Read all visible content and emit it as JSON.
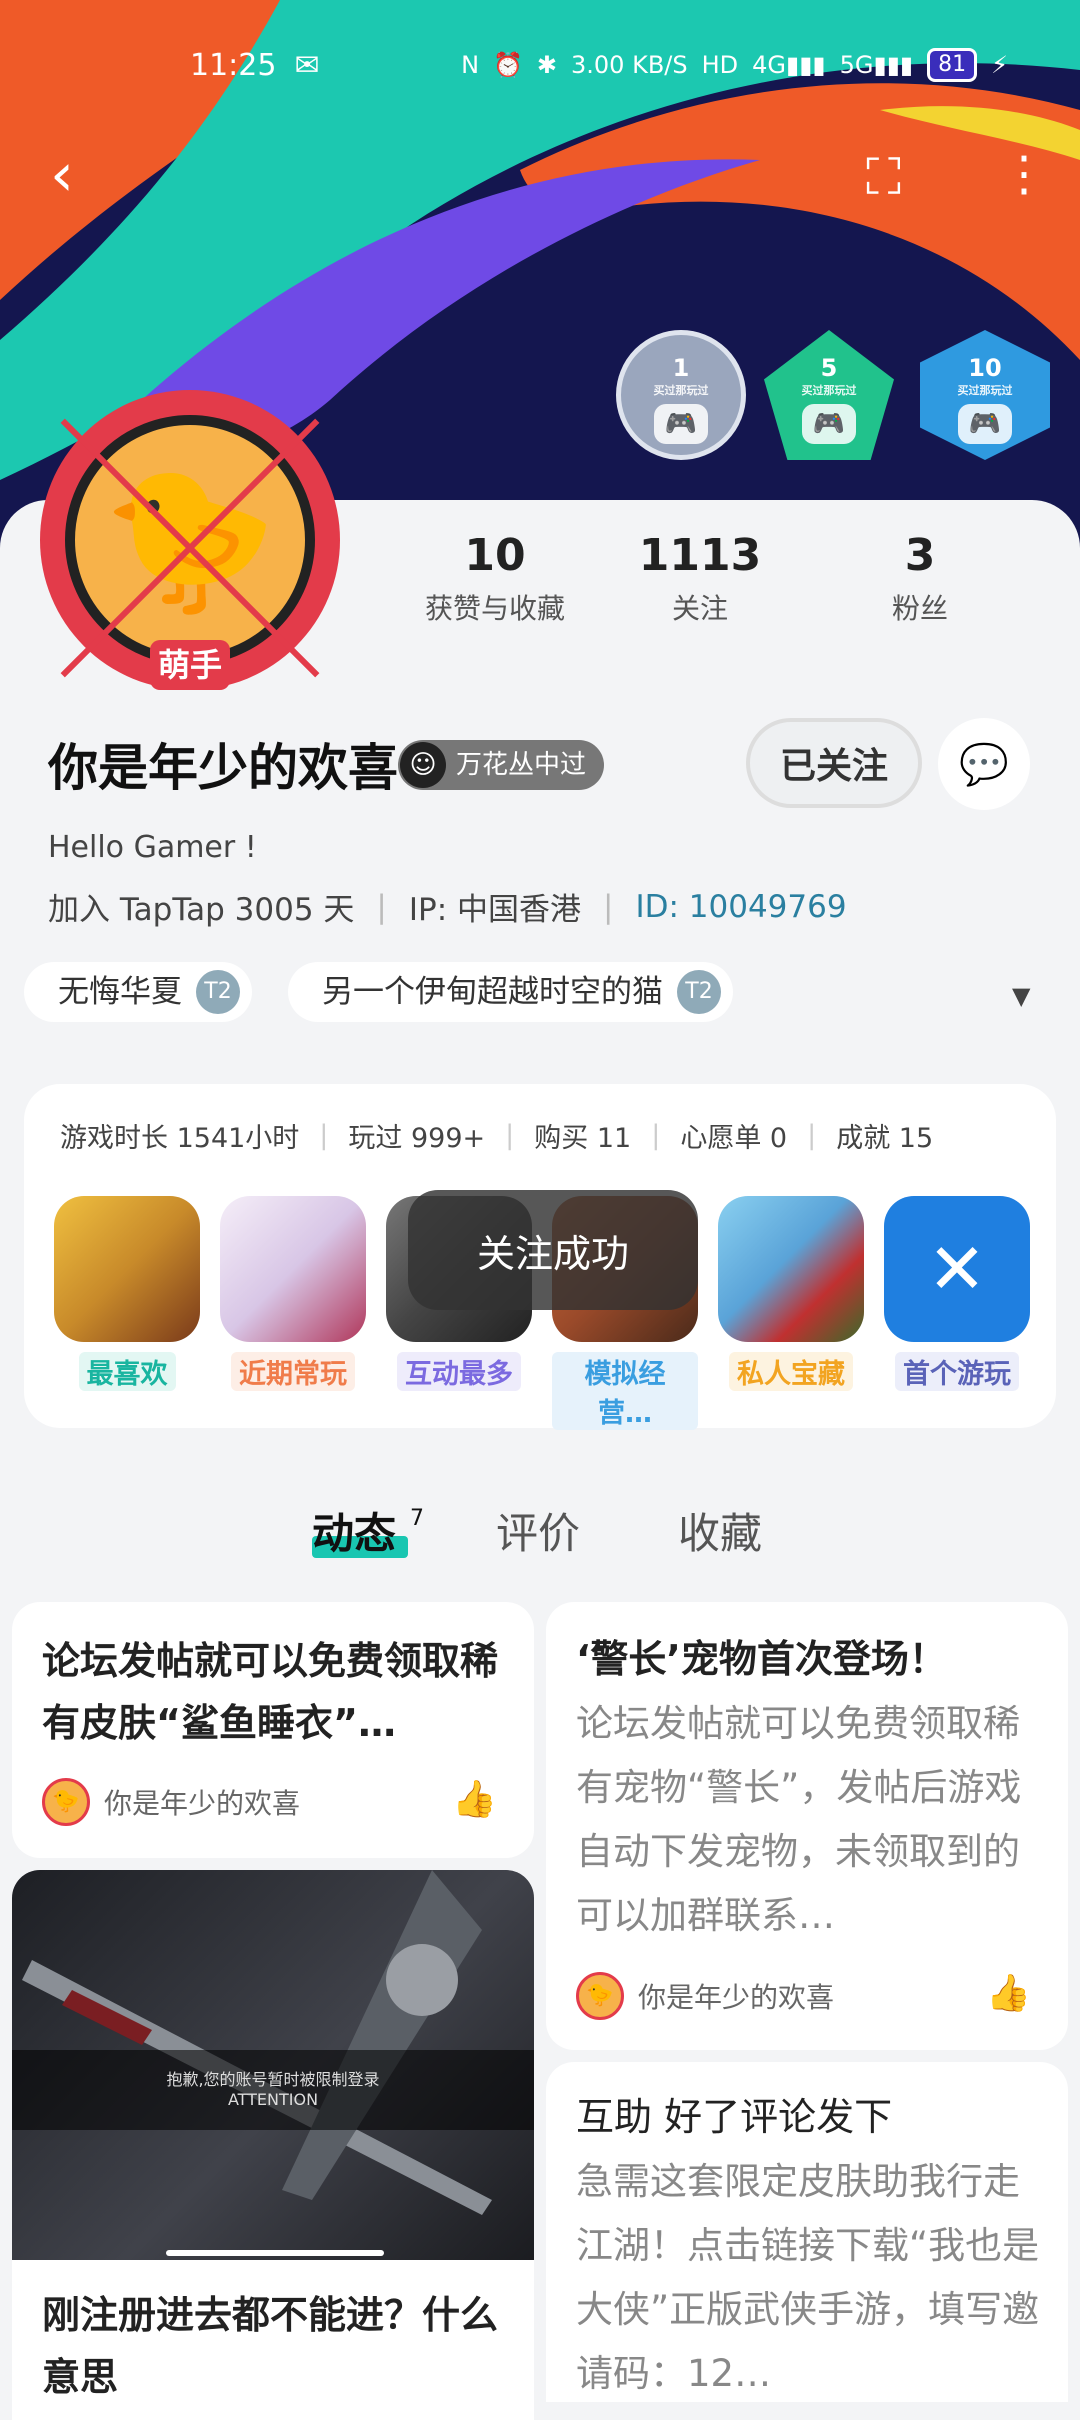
{
  "status_bar": {
    "time": "11:25",
    "network_speed": "3.00 KB/S",
    "battery": "81"
  },
  "badges": [
    {
      "value": "1",
      "sub": "买过那玩过",
      "color": "#9aa6bd"
    },
    {
      "value": "5",
      "sub": "买过那玩过",
      "color": "#21c28c"
    },
    {
      "value": "10",
      "sub": "买过那玩过",
      "color": "#2f9ae0"
    }
  ],
  "stats": [
    {
      "value": "10",
      "label": "获赞与收藏"
    },
    {
      "value": "1113",
      "label": "关注"
    },
    {
      "value": "3",
      "label": "粉丝"
    }
  ],
  "avatar_tag": "萌手",
  "user": {
    "name": "你是年少的欢喜",
    "title_badge": "万花丛中过",
    "bio": "Hello Gamer !",
    "joined": "加入 TapTap 3005 天",
    "ip": "IP: 中国香港",
    "id": "ID: 10049769"
  },
  "actions": {
    "follow_label": "已关注"
  },
  "chips": [
    {
      "label": "无悔华夏"
    },
    {
      "label": "另一个伊甸超越时空的猫"
    }
  ],
  "game_stats": [
    "游戏时长 1541小时",
    "玩过 999+",
    "购买 11",
    "心愿单 0",
    "成就 15"
  ],
  "games": [
    {
      "tag": "最喜欢",
      "tag_color": "#19b5a0",
      "tag_bg": "#e3f7f3",
      "icon_bg": "#c88a2a"
    },
    {
      "tag": "近期常玩",
      "tag_color": "#f07c4a",
      "tag_bg": "#fdeee6",
      "icon_bg": "#d8c6e6"
    },
    {
      "tag": "互动最多",
      "tag_color": "#7b6ae0",
      "tag_bg": "#eeecfb",
      "icon_bg": "#444"
    },
    {
      "tag": "模拟经营…",
      "tag_color": "#3a9ee0",
      "tag_bg": "#e6f2fb",
      "icon_bg": "#9a4a2a"
    },
    {
      "tag": "私人宝藏",
      "tag_color": "#f2a421",
      "tag_bg": "#fdf3e0",
      "icon_bg": "#5aa3d8"
    },
    {
      "tag": "首个游玩",
      "tag_color": "#5a63b8",
      "tag_bg": "#eceefa",
      "icon_bg": "#1f7fe0"
    }
  ],
  "toast": "关注成功",
  "tabs": [
    {
      "label": "动态",
      "count": "7"
    },
    {
      "label": "评价"
    },
    {
      "label": "收藏"
    }
  ],
  "posts": [
    {
      "title": "论坛发帖就可以免费领取稀有皮肤“鲨鱼睡衣”…",
      "author": "你是年少的欢喜"
    },
    {
      "title": "‘警长’宠物首次登场！",
      "body": "论坛发帖就可以免费领取稀有宠物“警长”，发帖后游戏自动下发宠物，未领取到的可以加群联系…",
      "author": "你是年少的欢喜"
    },
    {
      "caption_line1": "抱歉,您的账号暂时被限制登录",
      "caption_line2": "ATTENTION",
      "title": "刚注册进去都不能进？什么意思"
    },
    {
      "title": "互助 好了评论发下",
      "body": "急需这套限定皮肤助我行走江湖！点击链接下载“我也是大侠”正版武侠手游，填写邀请码：12…"
    }
  ]
}
